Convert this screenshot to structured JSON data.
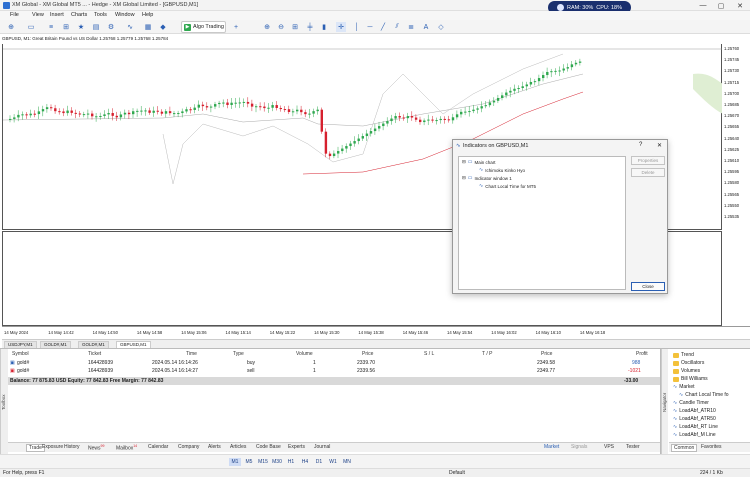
{
  "window": {
    "title": "XM Global - XM Global MT5 ... - Hedge - XM Global Limited - [GBPUSD,M1]",
    "controls": [
      "—",
      "▢",
      "✕"
    ]
  },
  "perf": {
    "ram": "RAM: 30%",
    "cpu": "CPU: 18%"
  },
  "menu": [
    "File",
    "View",
    "Insert",
    "Charts",
    "Tools",
    "Window",
    "Help"
  ],
  "toolbar": {
    "algo_label": "Algo Trading"
  },
  "chart": {
    "symbol_info": "GBPUSD, M1:  Great Britain Pound vs US Dollar  1.25768  1.25779  1.25768  1.25784",
    "price_labels": [
      "1.25760",
      "1.25745",
      "1.25730",
      "1.25715",
      "1.25700",
      "1.25685",
      "1.25670",
      "1.25655",
      "1.25640",
      "1.25625",
      "1.25610",
      "1.25595",
      "1.25580",
      "1.25565",
      "1.25550",
      "1.25535"
    ],
    "time_labels": [
      "14 May 2024",
      "14 May 14:42",
      "14 May 14:50",
      "14 May 14:58",
      "14 May 15:06",
      "14 May 15:14",
      "14 May 15:22",
      "14 May 15:30",
      "14 May 15:38",
      "14 May 15:46",
      "14 May 15:54",
      "14 May 16:02",
      "14 May 16:10",
      "14 May 16:18"
    ]
  },
  "chart_tabs": [
    "USDJPY,M1",
    "GOLD#,M1",
    "GOLD#,M1",
    "GBPUSD,M1"
  ],
  "dialog": {
    "title": "Indicators on GBPUSD,M1",
    "help": "?",
    "close_x": "✕",
    "items": {
      "main": "Main chart",
      "ichimoku": "Ichimoku Kinko Hyo",
      "subwin": "Indicator window 1",
      "clt": "Chart Local Time for MT5"
    },
    "buttons": {
      "properties": "Properties",
      "delete": "Delete",
      "close": "Close"
    }
  },
  "trade": {
    "headers": [
      "Symbol",
      "Ticket",
      "Time",
      "Type",
      "Volume",
      "Price",
      "S / L",
      "T / P",
      "Price",
      "Profit"
    ],
    "rows": [
      [
        "gold#",
        "164428939",
        "2024.05.14 16:14:26",
        "buy",
        "1",
        "2339.70",
        "",
        "",
        "2349.58",
        "988"
      ],
      [
        "gold#",
        "164428939",
        "2024.05.14 16:14:27",
        "sell",
        "1",
        "2339.56",
        "",
        "",
        "2349.77",
        "-1021"
      ]
    ],
    "balance": "Balance: 77 875.83 USD  Equity: 77 842.83  Free Margin: 77 842.83",
    "total": "-33.00"
  },
  "bottom_tabs": [
    "Trade",
    "Exposure",
    "History",
    "News",
    "Mailbox",
    "Calendar",
    "Company",
    "Alerts",
    "Articles",
    "Code Base",
    "Experts",
    "Journal"
  ],
  "news_badge": "99",
  "mailbox_badge": "14",
  "bottom_right": {
    "market": "Market",
    "signals": "Signals",
    "vps": "VPS",
    "tester": "Tester"
  },
  "toolbox_label": "Toolbox",
  "navigator": {
    "label": "Navigator",
    "items": [
      "Trend",
      "Oscillators",
      "Volumes",
      "Bill Williams",
      "Market",
      "Chart Local Time fo",
      "Candle Timer",
      "LoadAbf_ATR10",
      "LoadAbf_ATR50",
      "LoadAbf_RT Line",
      "LoadAbf_M Line"
    ],
    "tabs": [
      "Common",
      "Favorites"
    ]
  },
  "timeframes": [
    "M1",
    "M5",
    "M15",
    "M30",
    "H1",
    "H4",
    "D1",
    "W1",
    "MN"
  ],
  "status": {
    "help": "For Help, press F1",
    "profile": "Default",
    "traffic": "224 / 1 Kb"
  },
  "colors": {
    "bull": "#2fa84f",
    "bear": "#d6202e",
    "accent": "#2b5fb3",
    "kumo": "#dfeed3"
  }
}
